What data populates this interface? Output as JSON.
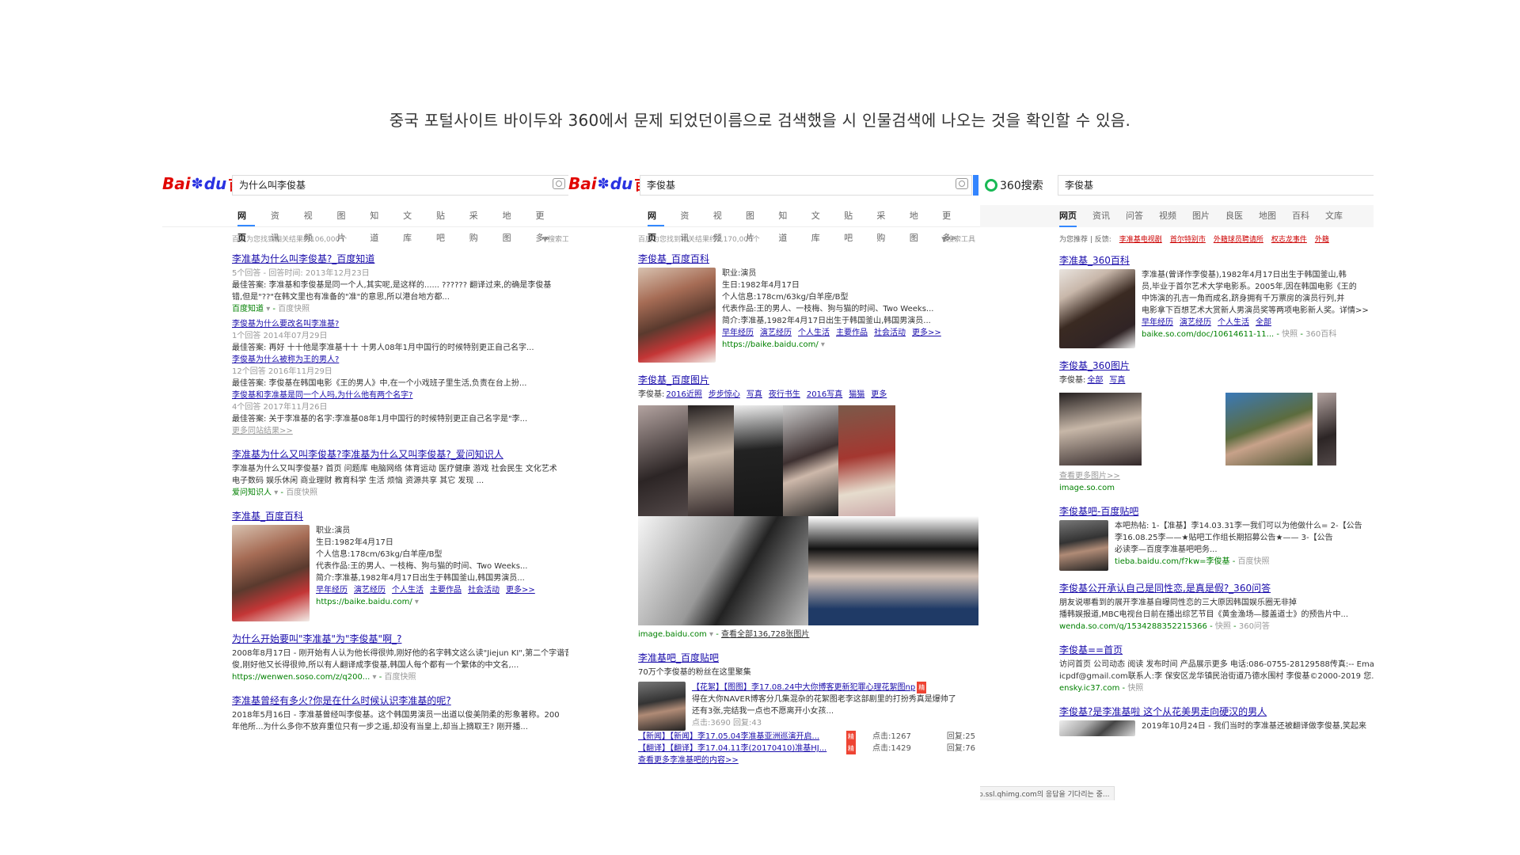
{
  "caption": "중국 포털사이트 바이두와 360에서 문제 되었던이름으로 검색했을 시 인물검색에 나오는 것을 확인할 수 있음.",
  "colors": {
    "baidu_red": "#e10601",
    "baidu_blue": "#2932e1",
    "link": "#1a0dab",
    "highlight": "#c00",
    "url_green": "#008000",
    "tab_active": "#3388ff",
    "so360_green": "#19b955"
  },
  "icons": [
    "baidu-paw-icon",
    "camera-icon",
    "so360-logo-icon",
    "dropdown-arrow-icon"
  ],
  "panel1": {
    "logo_a": "Bai",
    "logo_b": "du",
    "logo_cn": "百度",
    "query": "为什么叫李俊基",
    "tabs": [
      "网页",
      "资讯",
      "视频",
      "图片",
      "知道",
      "文库",
      "贴吧",
      "采购",
      "地图",
      "更多»"
    ],
    "count": "百度为您找到相关结果约106,000个",
    "tools": "搜索工",
    "r1": {
      "title": "李准基为什么叫李俊基?_百度知道",
      "l1": "5个回答 - 回答时间: 2013年12月23日",
      "l2": "最佳答案: 李准基和李俊基是同一个人,其实呢,是这样的...... ?????? 翻译过来,的确是李俊基",
      "l3": "错,但是\"??\"在韩文里也有准备的\"准\"的意思,所以港台地方都...",
      "src": "百度知道",
      "snap": "百度快照",
      "q1": "李俊基为什么要改名叫李准基?",
      "q1m": "1个回答  2014年07月29日",
      "q1a": "最佳答案: 再好 十十他是李准基十十 十男人08年1月中国行的时候特别更正自己名字...",
      "q2": "李俊基为什么被称为王的男人?",
      "q2m": "12个回答  2016年11月29日",
      "q2a": "最佳答案: 李俊基在韩国电影《王的男人》中,在一个小戏班子里生活,负责在台上扮...",
      "q3": "李俊基和李准基是同一个人吗,为什么他有两个名字?",
      "q3m": "4个回答  2017年11月26日",
      "q3a": "最佳答案: 关于李准基的名字:李准基08年1月中国行的时候特别更正自己名字是\"李...",
      "more": "更多同站结果>>"
    },
    "r2": {
      "title": "李准基为什么又叫李俊基?李准基为什么又叫李俊基?_爱问知识人",
      "l1": "李准基为什么又叫李俊基? 首页 问题库 电脑网络 体育运动 医疗健康 游戏 社会民生 文化艺术",
      "l2": "电子数码 娱乐休闲 商业理财 教育科学 生活 烦恼 资源共享 其它 发现 ...",
      "src": "爱问知识人",
      "snap": "百度快照"
    },
    "r3": {
      "title": "李准基_百度百科",
      "l1": "职业:演员",
      "l2": "生日:1982年4月17日",
      "l3": "个人信息:178cm/63kg/白羊座/B型",
      "l4": "代表作品:王的男人、一枝梅、狗与猫的时间、Two Weeks...",
      "l5": "简介:李准基,1982年4月17日出生于韩国釜山,韩国男演员...",
      "links": [
        "早年经历",
        "演艺经历",
        "个人生活",
        "主要作品",
        "社会活动",
        "更多>>"
      ],
      "url": "https://baike.baidu.com/"
    },
    "r4": {
      "title": "为什么开始要叫\"李准基\"为\"李俊基\"啊_?",
      "l1": "2008年8月17日 - 刚开始有人认为他长得很帅,刚好他的名字韩文这么读\"Jiejun KI\",第二个字谐音",
      "l2": "俊,刚好他又长得很帅,所以有人翻译成李俊基,韩国人每个都有一个繁体的中文名,...",
      "url": "https://wenwen.soso.com/z/q200...",
      "snap": "百度快照"
    },
    "r5": {
      "title": "李准基曾经有多火?你是在什么时候认识李准基的呢?",
      "l1": "2018年5月16日 - 李准基曾经叫李俊基。这个韩国男演员一出道以俊美阴柔的形象著称。200",
      "l2": "年他所...为什么多你不放弃重位只有一步之遥,却没有当皇上,却当上摘取王? 刚开播..."
    }
  },
  "panel2": {
    "logo_a": "Bai",
    "logo_b": "du",
    "logo_cn": "百度",
    "query": "李俊基",
    "tabs": [
      "网页",
      "资讯",
      "视频",
      "图片",
      "知道",
      "文库",
      "贴吧",
      "采购",
      "地图",
      "更多»"
    ],
    "count": "百度为您找到相关结果约2,170,000个",
    "tools": "搜索工具",
    "r1": {
      "title": "李俊基_百度百科",
      "l1": "职业:演员",
      "l2": "生日:1982年4月17日",
      "l3": "个人信息:178cm/63kg/白羊座/B型",
      "l4": "代表作品:王的男人、一枝梅、狗与猫的时间、Two Weeks...",
      "l5": "简介:李准基,1982年4月17日出生于韩国釜山,韩国男演员...",
      "links": [
        "早年经历",
        "演艺经历",
        "个人生活",
        "主要作品",
        "社会活动",
        "更多>>"
      ],
      "url": "https://baike.baidu.com/"
    },
    "r2": {
      "title": "李俊基_百度图片",
      "filter_label": "李俊基:",
      "filters": [
        "2016近照",
        "步步惊心",
        "写真",
        "夜行书生",
        "2016写真",
        "猫猫",
        "更多"
      ],
      "src": "image.baidu.com",
      "all": "查看全部136,728张图片"
    },
    "r3": {
      "title": "李准基吧_百度贴吧",
      "sub": "70万个李俊基的粉丝在这里聚集",
      "p1": "【花絮】【图图】李17.08.24中大你博客更新犯罪心理花絮图np",
      "p1b": "得在大你NAVER博客分几集混杂的花絮图老李这部剧里的打扮秀真是爆帅了",
      "p1c": "还有3张,完结我一点也不愿离开小女孩...",
      "p1m": "点击:3690     回复:43",
      "rows": [
        {
          "a": "【新闻】【新闻】李17.05.04李准基亚洲巡演开启...",
          "c": "点击:1267",
          "r": "回复:25"
        },
        {
          "a": "【翻译】【翻译】李17.04.11李(20170410)准基HJ...",
          "c": "点击:1429",
          "r": "回复:76"
        }
      ],
      "more": "查看更多李准基吧的内容>>"
    }
  },
  "panel3": {
    "logo_text": "360搜索",
    "query": "李俊基",
    "tabs": [
      "网页",
      "资讯",
      "问答",
      "视频",
      "图片",
      "良医",
      "地图",
      "百科",
      "文库"
    ],
    "suggest_label": "为您推荐 | 反馈:",
    "suggest": [
      "李准基电视剧",
      "首尔特别市",
      "外籍球员聘请所",
      "权志龙事件",
      "外籍"
    ],
    "r1": {
      "title": "李准基_360百科",
      "l1": "李准基(曾译作李俊基),1982年4月17日出生于韩国釜山,韩",
      "l2": "员,毕业于首尔艺术大学电影系。2005年,因在韩国电影《王的",
      "l3": "中饰演的孔吉一角而成名,跻身拥有千万票房的演员行列,并",
      "l4": "电影拿下百想艺术大赏新人男演员奖等两项电影新人奖。详情>>",
      "links": [
        "早年经历",
        "演艺经历",
        "个人生活",
        "全部"
      ],
      "url": "baike.so.com/doc/10614611-11...",
      "snap": "快照",
      "v": "360百科"
    },
    "r2": {
      "title": "李俊基_360图片",
      "label": "李俊基:",
      "links": [
        "全部",
        "写真"
      ],
      "more": "查看更多图片>>",
      "src": "image.so.com"
    },
    "r3": {
      "title": "李俊基吧-百度贴吧",
      "l1": "本吧热帖: 1-【准基】李14.03.31李一我们可以为他做什么= 2-【公告",
      "l2": "李16.08.25李——★贴吧工作组长期招募公告★—— 3-【公告",
      "l3": "必读李—百度李准基吧吧务...",
      "url": "tieba.baidu.com/f?kw=李俊基",
      "snap": "百度快照"
    },
    "r4": {
      "title": "李俊基公开承认自己是同性恋,是真是假?_360问答",
      "l1": "朋友说哪看到的展开李准基自曝同性恋的三大原因韩国娱乐圈无非掉",
      "l2": "播韩娱报道,MBC电视台日前在播出综艺节目《黄金渔场—膝盖道士》的预告片中...",
      "url": "wenda.so.com/q/1534288352215366",
      "snap": "快照",
      "v": "360问答"
    },
    "r5": {
      "title": "李俊基==首页",
      "l1": "访问首页 公司动态 阅读 发布时间 产品展示更多 电话:086-0755-28129588传真:-- Email",
      "l2": "icpdf@gmail.com联系人:李 保安区龙华镇民治街道乃德水围村 李俊基©2000-2019 您...",
      "url": "ensky.ic37.com",
      "snap": "快照"
    },
    "r6": {
      "title": "李俊基?是李准基啦 这个从花美男走向硬汉的男人",
      "l1": "2019年10月24日 - 我们当时的李准基还被翻译做李俊基,笑起来"
    },
    "status": "p.ssl.qhimg.com의 응답을 기다리는 중..."
  }
}
